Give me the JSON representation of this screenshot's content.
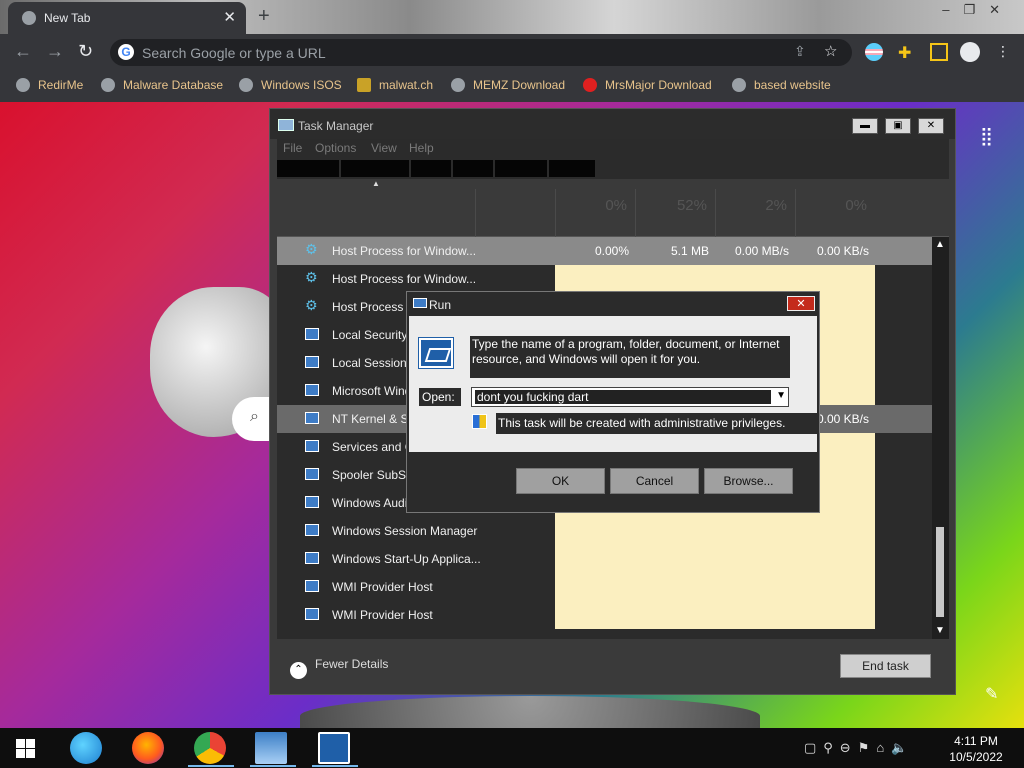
{
  "browser": {
    "tab_title": "New Tab",
    "tab_close": "✕",
    "new_tab": "+",
    "omnibox_placeholder": "Search Google or type a URL",
    "bookmarks": [
      {
        "label": "RedirMe"
      },
      {
        "label": "Malware Database"
      },
      {
        "label": "Windows ISOS"
      },
      {
        "label": "malwat.ch"
      },
      {
        "label": "MEMZ Download"
      },
      {
        "label": "MrsMajor Download"
      },
      {
        "label": "based website"
      }
    ]
  },
  "task_manager": {
    "title": "Task Manager",
    "menu": [
      "File",
      "Options",
      "View",
      "Help"
    ],
    "header_percents": [
      "0%",
      "52%",
      "2%",
      "0%"
    ],
    "rows": [
      {
        "name": "Host Process for Window...",
        "cpu": "0.00%",
        "memory": "5.1 MB",
        "disk": "0.00 MB/s",
        "network": "0.00 KB/s",
        "icon": "gear-icon"
      },
      {
        "name": "Host Process for Window...",
        "cpu": "",
        "memory": "",
        "disk": "",
        "network": "",
        "icon": "gear-icon"
      },
      {
        "name": "Host Process fo",
        "cpu": "",
        "memory": "",
        "disk": "",
        "network": "",
        "icon": "gear-icon"
      },
      {
        "name": "Local Security A",
        "cpu": "",
        "memory": "",
        "disk": "",
        "network": "",
        "icon": "window-icon"
      },
      {
        "name": "Local Session M",
        "cpu": "",
        "memory": "",
        "disk": "",
        "network": "",
        "icon": "window-icon"
      },
      {
        "name": "Microsoft Windo",
        "cpu": "",
        "memory": "",
        "disk": "",
        "network": "",
        "icon": "window-icon"
      },
      {
        "name": "NT Kernel & Sys",
        "cpu": "",
        "memory": "",
        "disk": "",
        "network": "0.00 KB/s",
        "icon": "window-icon"
      },
      {
        "name": "Services and Co",
        "cpu": "",
        "memory": "",
        "disk": "",
        "network": "",
        "icon": "window-icon"
      },
      {
        "name": "Spooler SubSys",
        "cpu": "",
        "memory": "",
        "disk": "",
        "network": "",
        "icon": "window-icon"
      },
      {
        "name": "Windows Audio",
        "cpu": "",
        "memory": "",
        "disk": "",
        "network": "",
        "icon": "window-icon"
      },
      {
        "name": "Windows Session Manager",
        "cpu": "",
        "memory": "",
        "disk": "",
        "network": "",
        "icon": "window-icon"
      },
      {
        "name": "Windows Start-Up Applica...",
        "cpu": "",
        "memory": "",
        "disk": "",
        "network": "",
        "icon": "window-icon"
      },
      {
        "name": "WMI Provider Host",
        "cpu": "",
        "memory": "",
        "disk": "",
        "network": "",
        "icon": "window-icon"
      },
      {
        "name": "WMI Provider Host",
        "cpu": "",
        "memory": "",
        "disk": "",
        "network": "",
        "icon": "window-icon"
      }
    ],
    "fewer_details": "Fewer Details",
    "end_task": "End task"
  },
  "run_dialog": {
    "title": "Run",
    "description": "Type the name of a program, folder, document, or Internet resource, and Windows will open it for you.",
    "open_label": "Open:",
    "open_value": "dont you fucking dart",
    "admin_note": "This task will be created with administrative privileges.",
    "ok": "OK",
    "cancel": "Cancel",
    "browse": "Browse..."
  },
  "taskbar": {
    "time": "4:11 PM",
    "date": "10/5/2022"
  },
  "colors": {
    "bookmark_text": "#e8c48c",
    "tm_highlight": "#fbefc0",
    "run_close": "#c42b1c"
  }
}
